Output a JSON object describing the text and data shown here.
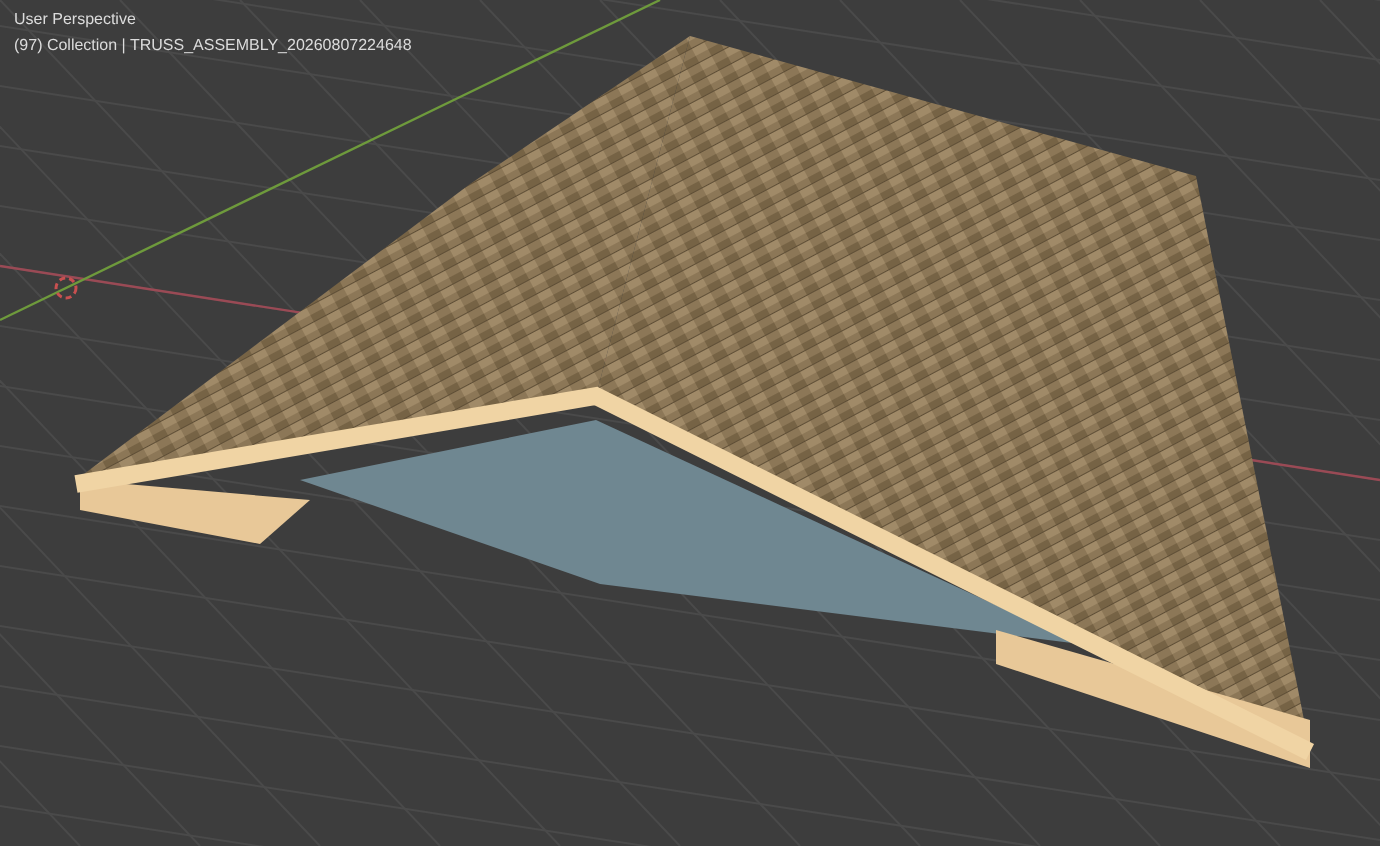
{
  "viewport": {
    "view_name": "User Perspective",
    "collection_info": "(97) Collection | TRUSS_ASSEMBLY_20260807224648"
  }
}
